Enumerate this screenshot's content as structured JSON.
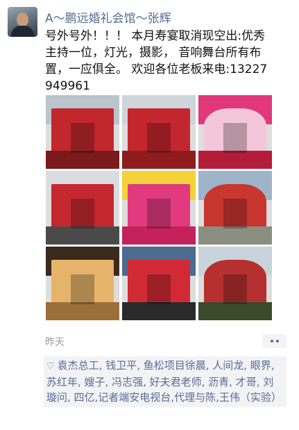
{
  "post": {
    "author": "A～鹏远婚礼会馆～张辉",
    "content": "号外号外！！！ 本月寿宴取消现空出:优秀主持一位，灯光，摄影， 音响舞台所有布置，一应俱全。 欢迎各位老板来电:13227949961",
    "time": "昨天",
    "likes_icon": "heart-outline-icon",
    "likes": "袁杰总工, 钱卫平, 鱼松项目徐晨, 人间龙, 眼界, 苏红年, 嫂子, 冯志强, 好夫君老师, 沥青, 才哥, 刘璇问, 四亿,记者端安电视台,代理与陈,王伟（实验）"
  },
  "photos": [
    {
      "name": "photo-red-wedding-archway-street",
      "colors": [
        "#b9c4cc",
        "#c1272d",
        "#7a1a1a"
      ]
    },
    {
      "name": "photo-red-archway-gate",
      "colors": [
        "#cfd5da",
        "#c4262e",
        "#8f1c1c"
      ]
    },
    {
      "name": "photo-pink-tent-interior",
      "colors": [
        "#e0387a",
        "#f3c6d9",
        "#b31d3a"
      ]
    },
    {
      "name": "photo-red-tent-entrance",
      "colors": [
        "#d9dde2",
        "#c5282f",
        "#4a4a4a"
      ]
    },
    {
      "name": "photo-pink-banquet-hall",
      "colors": [
        "#f4d23a",
        "#e23a7f",
        "#c5215a"
      ]
    },
    {
      "name": "photo-red-tent-outdoor",
      "colors": [
        "#9eb4c8",
        "#c9352f",
        "#8a8f80"
      ]
    },
    {
      "name": "photo-stage-lighting-hall",
      "colors": [
        "#3a2a1e",
        "#e6b36a",
        "#9c6f3a"
      ]
    },
    {
      "name": "photo-red-carpet-courtyard",
      "colors": [
        "#4d6a8f",
        "#d12a34",
        "#2a2a2a"
      ]
    },
    {
      "name": "photo-motorcycle-parade",
      "colors": [
        "#c9d3da",
        "#b5302f",
        "#3b4a2a"
      ]
    }
  ]
}
